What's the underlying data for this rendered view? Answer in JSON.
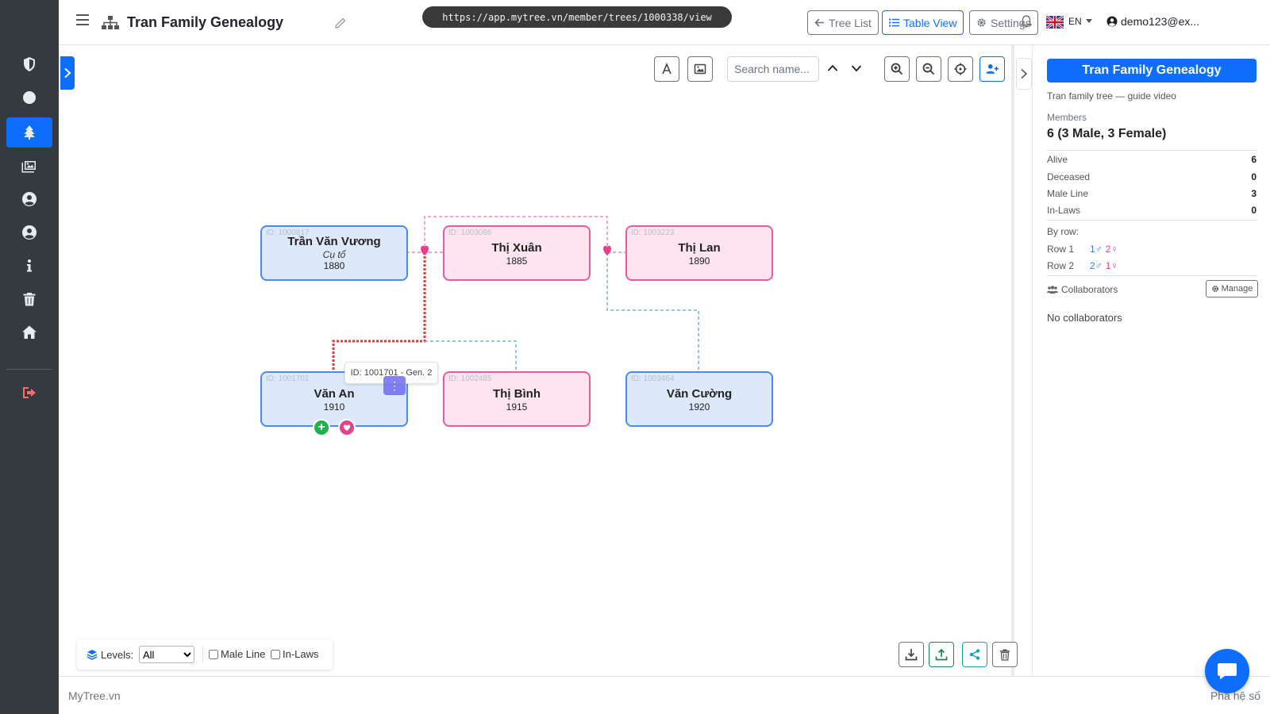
{
  "header": {
    "title": "Tran Family Genealogy",
    "url": "https://app.mytree.vn/member/trees/1000338/view",
    "buttons": {
      "tree_list": "Tree List",
      "table_view": "Table View",
      "settings": "Settings"
    },
    "lang": "EN",
    "user": "demo123@ex..."
  },
  "sidebar": {
    "items": [
      {
        "icon": "shield-icon"
      },
      {
        "icon": "circle-icon"
      },
      {
        "icon": "tree-icon",
        "active": true
      },
      {
        "icon": "images-icon"
      },
      {
        "icon": "user-circle-icon"
      },
      {
        "icon": "user-circle-icon"
      },
      {
        "icon": "info-icon"
      },
      {
        "icon": "trash-icon"
      },
      {
        "icon": "home-icon"
      },
      {
        "icon": "logout-icon"
      }
    ]
  },
  "toolbar": {
    "search_placeholder": "Search name..."
  },
  "tree": {
    "people": [
      {
        "id": "ID: 1000817",
        "name": "Trần Văn Vương",
        "alias": "Cụ tổ",
        "year": "1880",
        "gender": "male"
      },
      {
        "id": "ID: 1003086",
        "name": "Thị Xuân",
        "alias": "",
        "year": "1885",
        "gender": "female"
      },
      {
        "id": "ID: 1003223",
        "name": "Thị Lan",
        "alias": "",
        "year": "1890",
        "gender": "female"
      },
      {
        "id": "ID: 1001701",
        "name": "Văn An",
        "alias": "",
        "year": "1910",
        "gender": "male"
      },
      {
        "id": "ID: 1002485",
        "name": "Thị Bình",
        "alias": "",
        "year": "1915",
        "gender": "female"
      },
      {
        "id": "ID: 1003464",
        "name": "Văn Cường",
        "alias": "",
        "year": "1920",
        "gender": "male"
      }
    ],
    "tooltip": "ID: 1001701 - Gen. 2",
    "menu_label": "⋮",
    "add_label": "+"
  },
  "filter": {
    "levels_label": "Levels:",
    "levels_value": "All",
    "male_line": "Male Line",
    "in_laws": "In-Laws"
  },
  "info": {
    "title": "Tran Family Genealogy",
    "subtitle": "Tran family tree — guide video",
    "members_label": "Members",
    "members_count": "6 (3 Male, 3 Female)",
    "stats": [
      {
        "label": "Alive",
        "value": "6"
      },
      {
        "label": "Deceased",
        "value": "0"
      },
      {
        "label": "Male Line",
        "value": "3"
      },
      {
        "label": "In-Laws",
        "value": "0"
      }
    ],
    "by_row_label": "By row:",
    "rows": [
      {
        "label": "Row 1",
        "male": "1♂",
        "female": "2♀"
      },
      {
        "label": "Row 2",
        "male": "2♂",
        "female": "1♀"
      }
    ],
    "collaborators_label": "Collaborators",
    "manage_label": "Manage",
    "no_collaborators": "No collaborators"
  },
  "footer": {
    "left": "MyTree.vn",
    "right": "Phả hệ số"
  },
  "colors": {
    "primary": "#0d6efd",
    "male": "#4a8be8",
    "female": "#e85c9d",
    "sidebar": "#343a40"
  }
}
